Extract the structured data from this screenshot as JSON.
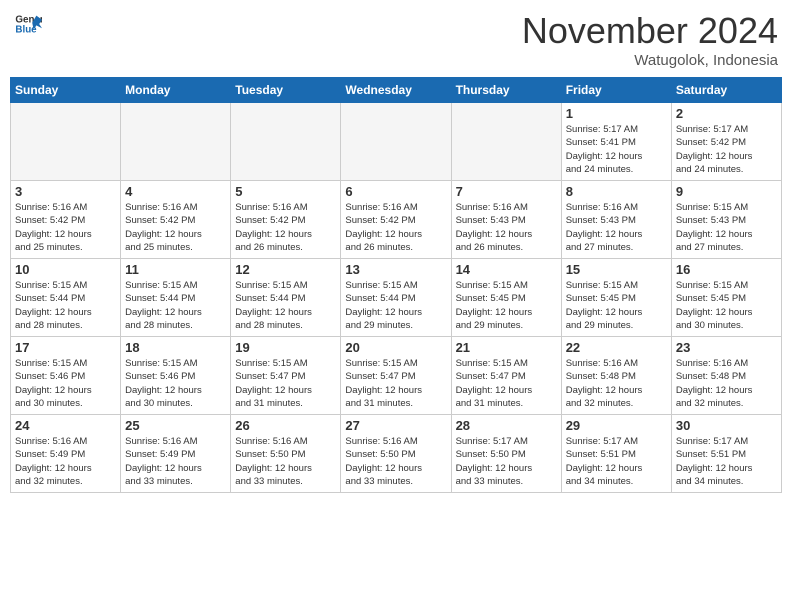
{
  "header": {
    "logo_line1": "General",
    "logo_line2": "Blue",
    "month": "November 2024",
    "location": "Watugolok, Indonesia"
  },
  "weekdays": [
    "Sunday",
    "Monday",
    "Tuesday",
    "Wednesday",
    "Thursday",
    "Friday",
    "Saturday"
  ],
  "weeks": [
    [
      {
        "day": "",
        "info": ""
      },
      {
        "day": "",
        "info": ""
      },
      {
        "day": "",
        "info": ""
      },
      {
        "day": "",
        "info": ""
      },
      {
        "day": "",
        "info": ""
      },
      {
        "day": "1",
        "info": "Sunrise: 5:17 AM\nSunset: 5:41 PM\nDaylight: 12 hours\nand 24 minutes."
      },
      {
        "day": "2",
        "info": "Sunrise: 5:17 AM\nSunset: 5:42 PM\nDaylight: 12 hours\nand 24 minutes."
      }
    ],
    [
      {
        "day": "3",
        "info": "Sunrise: 5:16 AM\nSunset: 5:42 PM\nDaylight: 12 hours\nand 25 minutes."
      },
      {
        "day": "4",
        "info": "Sunrise: 5:16 AM\nSunset: 5:42 PM\nDaylight: 12 hours\nand 25 minutes."
      },
      {
        "day": "5",
        "info": "Sunrise: 5:16 AM\nSunset: 5:42 PM\nDaylight: 12 hours\nand 26 minutes."
      },
      {
        "day": "6",
        "info": "Sunrise: 5:16 AM\nSunset: 5:42 PM\nDaylight: 12 hours\nand 26 minutes."
      },
      {
        "day": "7",
        "info": "Sunrise: 5:16 AM\nSunset: 5:43 PM\nDaylight: 12 hours\nand 26 minutes."
      },
      {
        "day": "8",
        "info": "Sunrise: 5:16 AM\nSunset: 5:43 PM\nDaylight: 12 hours\nand 27 minutes."
      },
      {
        "day": "9",
        "info": "Sunrise: 5:15 AM\nSunset: 5:43 PM\nDaylight: 12 hours\nand 27 minutes."
      }
    ],
    [
      {
        "day": "10",
        "info": "Sunrise: 5:15 AM\nSunset: 5:44 PM\nDaylight: 12 hours\nand 28 minutes."
      },
      {
        "day": "11",
        "info": "Sunrise: 5:15 AM\nSunset: 5:44 PM\nDaylight: 12 hours\nand 28 minutes."
      },
      {
        "day": "12",
        "info": "Sunrise: 5:15 AM\nSunset: 5:44 PM\nDaylight: 12 hours\nand 28 minutes."
      },
      {
        "day": "13",
        "info": "Sunrise: 5:15 AM\nSunset: 5:44 PM\nDaylight: 12 hours\nand 29 minutes."
      },
      {
        "day": "14",
        "info": "Sunrise: 5:15 AM\nSunset: 5:45 PM\nDaylight: 12 hours\nand 29 minutes."
      },
      {
        "day": "15",
        "info": "Sunrise: 5:15 AM\nSunset: 5:45 PM\nDaylight: 12 hours\nand 29 minutes."
      },
      {
        "day": "16",
        "info": "Sunrise: 5:15 AM\nSunset: 5:45 PM\nDaylight: 12 hours\nand 30 minutes."
      }
    ],
    [
      {
        "day": "17",
        "info": "Sunrise: 5:15 AM\nSunset: 5:46 PM\nDaylight: 12 hours\nand 30 minutes."
      },
      {
        "day": "18",
        "info": "Sunrise: 5:15 AM\nSunset: 5:46 PM\nDaylight: 12 hours\nand 30 minutes."
      },
      {
        "day": "19",
        "info": "Sunrise: 5:15 AM\nSunset: 5:47 PM\nDaylight: 12 hours\nand 31 minutes."
      },
      {
        "day": "20",
        "info": "Sunrise: 5:15 AM\nSunset: 5:47 PM\nDaylight: 12 hours\nand 31 minutes."
      },
      {
        "day": "21",
        "info": "Sunrise: 5:15 AM\nSunset: 5:47 PM\nDaylight: 12 hours\nand 31 minutes."
      },
      {
        "day": "22",
        "info": "Sunrise: 5:16 AM\nSunset: 5:48 PM\nDaylight: 12 hours\nand 32 minutes."
      },
      {
        "day": "23",
        "info": "Sunrise: 5:16 AM\nSunset: 5:48 PM\nDaylight: 12 hours\nand 32 minutes."
      }
    ],
    [
      {
        "day": "24",
        "info": "Sunrise: 5:16 AM\nSunset: 5:49 PM\nDaylight: 12 hours\nand 32 minutes."
      },
      {
        "day": "25",
        "info": "Sunrise: 5:16 AM\nSunset: 5:49 PM\nDaylight: 12 hours\nand 33 minutes."
      },
      {
        "day": "26",
        "info": "Sunrise: 5:16 AM\nSunset: 5:50 PM\nDaylight: 12 hours\nand 33 minutes."
      },
      {
        "day": "27",
        "info": "Sunrise: 5:16 AM\nSunset: 5:50 PM\nDaylight: 12 hours\nand 33 minutes."
      },
      {
        "day": "28",
        "info": "Sunrise: 5:17 AM\nSunset: 5:50 PM\nDaylight: 12 hours\nand 33 minutes."
      },
      {
        "day": "29",
        "info": "Sunrise: 5:17 AM\nSunset: 5:51 PM\nDaylight: 12 hours\nand 34 minutes."
      },
      {
        "day": "30",
        "info": "Sunrise: 5:17 AM\nSunset: 5:51 PM\nDaylight: 12 hours\nand 34 minutes."
      }
    ]
  ]
}
